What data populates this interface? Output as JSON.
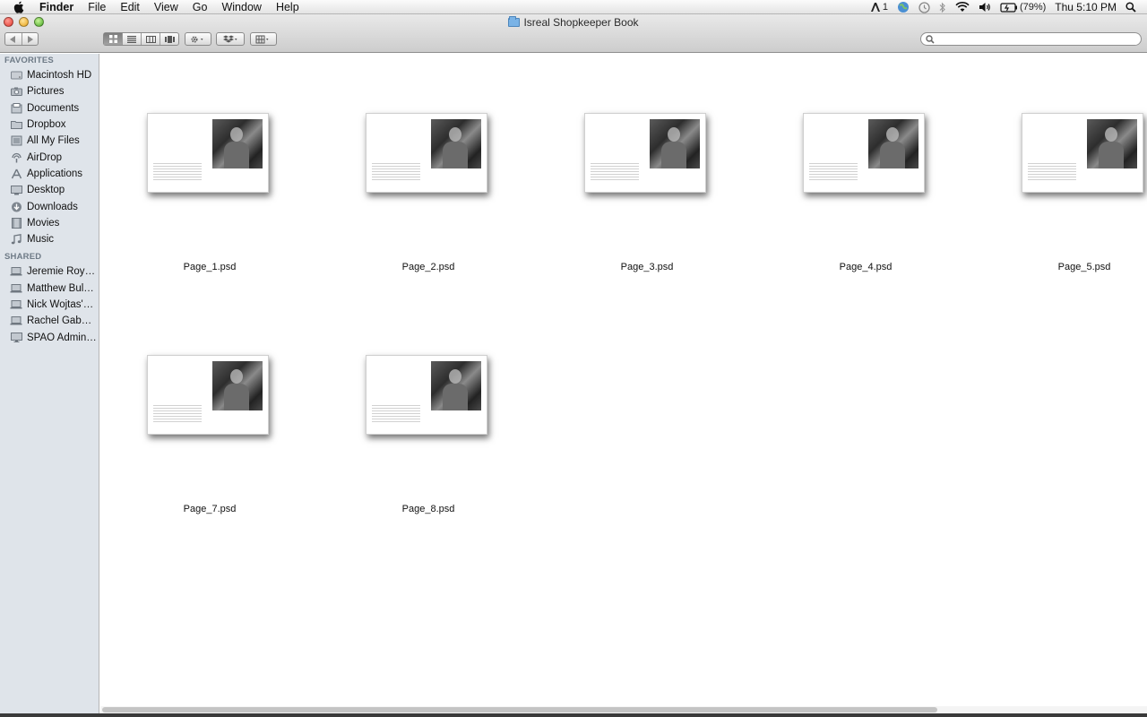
{
  "menubar": {
    "app": "Finder",
    "items": [
      "File",
      "Edit",
      "View",
      "Go",
      "Window",
      "Help"
    ],
    "status": {
      "adobe": "1",
      "battery": "(79%)",
      "clock": "Thu 5:10 PM"
    }
  },
  "window": {
    "title": "Isreal Shopkeeper Book"
  },
  "search": {
    "value": "",
    "placeholder": ""
  },
  "sidebar": {
    "favorites_label": "FAVORITES",
    "favorites": [
      {
        "label": "Macintosh HD",
        "icon": "hard-drive-icon"
      },
      {
        "label": "Pictures",
        "icon": "camera-icon"
      },
      {
        "label": "Documents",
        "icon": "documents-icon"
      },
      {
        "label": "Dropbox",
        "icon": "folder-icon"
      },
      {
        "label": "All My Files",
        "icon": "all-files-icon"
      },
      {
        "label": "AirDrop",
        "icon": "airdrop-icon"
      },
      {
        "label": "Applications",
        "icon": "applications-icon"
      },
      {
        "label": "Desktop",
        "icon": "desktop-icon"
      },
      {
        "label": "Downloads",
        "icon": "downloads-icon"
      },
      {
        "label": "Movies",
        "icon": "movies-icon"
      },
      {
        "label": "Music",
        "icon": "music-icon"
      }
    ],
    "shared_label": "SHARED",
    "shared": [
      {
        "label": "Jeremie Roy's…",
        "icon": "laptop-icon"
      },
      {
        "label": "Matthew Bula'…",
        "icon": "laptop-icon"
      },
      {
        "label": "Nick Wojtas's…",
        "icon": "laptop-icon"
      },
      {
        "label": "Rachel Gabou…",
        "icon": "laptop-icon"
      },
      {
        "label": "SPAO Adminis…",
        "icon": "display-icon"
      }
    ]
  },
  "files": [
    {
      "name": "Page_1.psd"
    },
    {
      "name": "Page_2.psd"
    },
    {
      "name": "Page_3.psd"
    },
    {
      "name": "Page_4.psd"
    },
    {
      "name": "Page_5.psd"
    },
    {
      "name": "Page_7.psd"
    },
    {
      "name": "Page_8.psd"
    }
  ]
}
